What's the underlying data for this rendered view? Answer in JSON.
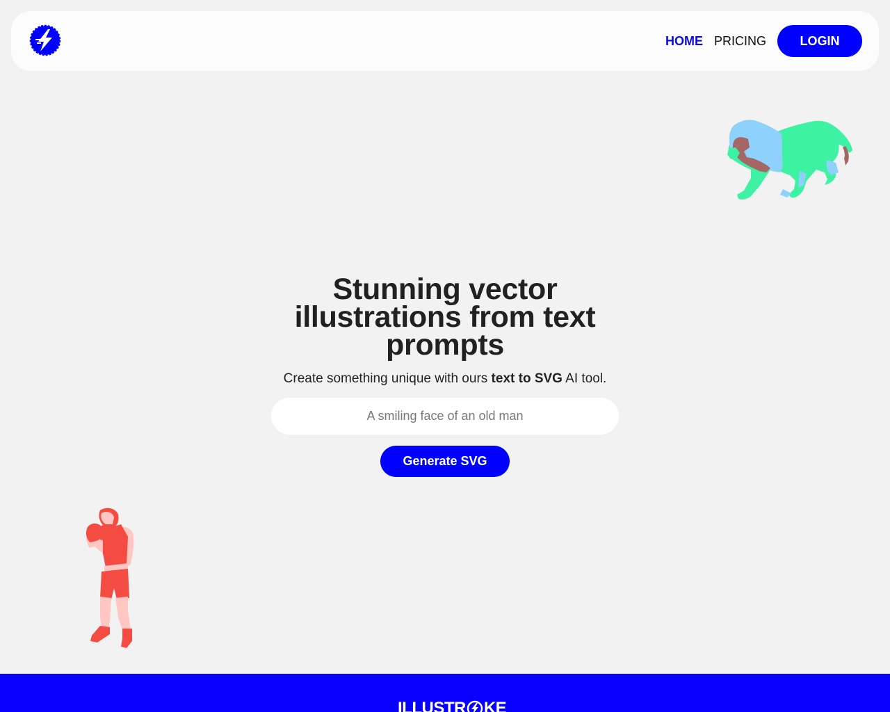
{
  "header": {
    "logo_icon": "lightning-bolt-logo-icon",
    "nav": {
      "home_label": "HOME",
      "pricing_label": "PRICING",
      "login_label": "LOGIN"
    }
  },
  "hero": {
    "title": "Stunning vector illustrations from text prompts",
    "subtitle_before": "Create something unique with ours ",
    "subtitle_bold": "text to SVG",
    "subtitle_after": " AI tool.",
    "input_placeholder": "A smiling face of an old man",
    "generate_label": "Generate SVG"
  },
  "illustrations": {
    "top_right": "lion-illustration",
    "bottom_left": "boxer-illustration"
  },
  "footer": {
    "brand_left": "ILLUSTR",
    "brand_right": "KE"
  },
  "colors": {
    "accent": "#0000ff",
    "background": "#f2f2f2",
    "footer": "#0800ff"
  }
}
